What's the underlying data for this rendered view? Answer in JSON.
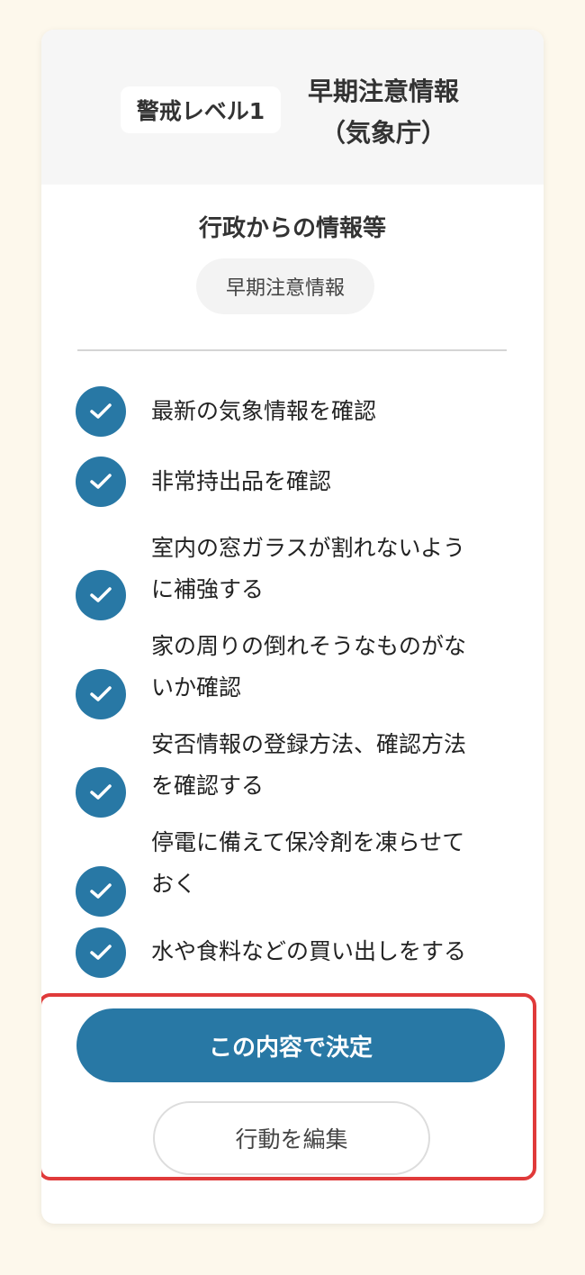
{
  "header": {
    "level_badge": "警戒レベル1",
    "title_line1": "早期注意情報",
    "title_line2": "（気象庁）"
  },
  "info": {
    "heading": "行政からの情報等",
    "pill": "早期注意情報"
  },
  "checklist": [
    {
      "text_line1": "最新の気象情報を確認",
      "text_line2": "",
      "checked": true
    },
    {
      "text_line1": "非常持出品を確認",
      "text_line2": "",
      "checked": true
    },
    {
      "text_line1": "室内の窓ガラスが割れないよう",
      "text_line2": "に補強する",
      "checked": true
    },
    {
      "text_line1": "家の周りの倒れそうなものがな",
      "text_line2": "いか確認",
      "checked": true
    },
    {
      "text_line1": "安否情報の登録方法、確認方法",
      "text_line2": "を確認する",
      "checked": true
    },
    {
      "text_line1": "停電に備えて保冷剤を凍らせて",
      "text_line2": "おく",
      "checked": true
    },
    {
      "text_line1": "水や食料などの買い出しをする",
      "text_line2": "",
      "checked": true
    }
  ],
  "actions": {
    "decide_label": "この内容で決定",
    "edit_label": "行動を編集"
  },
  "icons": {
    "check": "check-icon"
  },
  "colors": {
    "accent": "#2878a5",
    "highlight": "#e03a3a",
    "background": "#fdf8ec"
  }
}
